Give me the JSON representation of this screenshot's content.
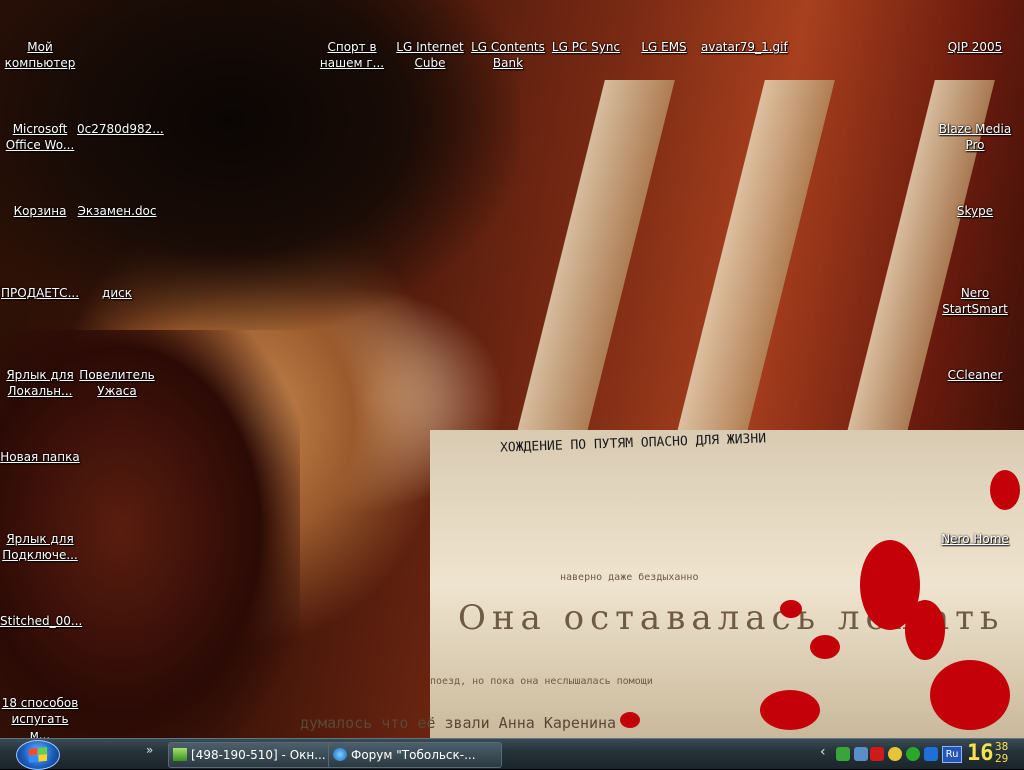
{
  "desktop": {
    "wall_text_small": "ХОЖДЕНИЕ ПО ПУТЯМ ОПАСНО ДЛЯ ЖИЗНИ",
    "wall_text_big": "Она оставалась лежать",
    "wall_text_line1": "наверно даже бездыханно",
    "wall_text_line2": "поезд, но пока она неслышалась помощи",
    "wall_text_line3": "думалось что её звали Анна Каренина",
    "icons": [
      {
        "label": "Мой компьютер"
      },
      {
        "label": "Спорт в нашем г..."
      },
      {
        "label": "LG Internet Cube"
      },
      {
        "label": "LG Contents Bank"
      },
      {
        "label": "LG PC Sync"
      },
      {
        "label": "LG EMS"
      },
      {
        "label": "avatar79_1.gif"
      },
      {
        "label": "QIP 2005"
      },
      {
        "label": "Microsoft Office Wo..."
      },
      {
        "label": "0c2780d982..."
      },
      {
        "label": "Blaze Media Pro"
      },
      {
        "label": "Корзина"
      },
      {
        "label": "Экзамен.doc"
      },
      {
        "label": "Skype"
      },
      {
        "label": "ПРОДАЕТС..."
      },
      {
        "label": "диск"
      },
      {
        "label": "Nero StartSmart"
      },
      {
        "label": "Ярлык для Локальн..."
      },
      {
        "label": "Повелитель Ужаса"
      },
      {
        "label": "CCleaner"
      },
      {
        "label": "Новая папка"
      },
      {
        "label": "Ярлык для Подключе..."
      },
      {
        "label": "Nero Home"
      },
      {
        "label": "Stitched_00..."
      },
      {
        "label": "18 способов испугать м..."
      }
    ]
  },
  "taskbar": {
    "quick_launch_arrow": "»",
    "tasks": [
      {
        "label": "[498-190-510] - Окн..."
      },
      {
        "label": "Форум \"Тобольск-..."
      }
    ],
    "tray_arrow": "‹",
    "language": "Ru",
    "clock_hour": "16",
    "clock_min1": "38",
    "clock_min2": "29"
  },
  "colors": {
    "icon_text": "#ffffff",
    "clock": "#f7e34a",
    "taskbar": "#26333b",
    "blood": "#c40008"
  }
}
